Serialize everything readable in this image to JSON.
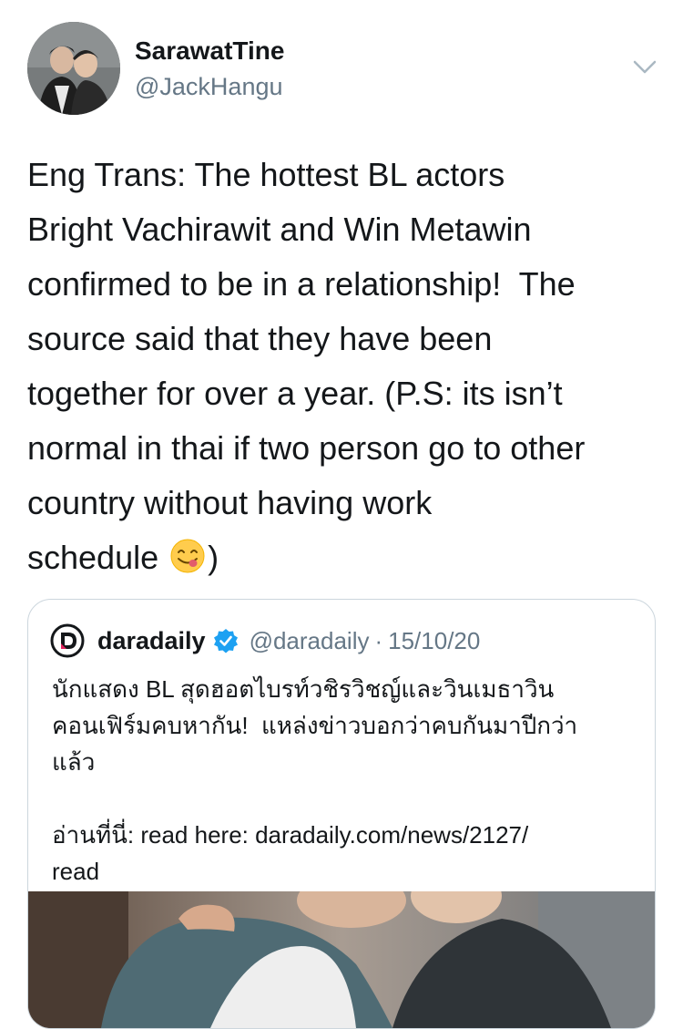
{
  "author": {
    "name": "SarawatTine",
    "handle": "@JackHangu"
  },
  "tweet": {
    "text": "Eng Trans: The hottest BL actors\nBright Vachirawit and Win Metawin\nconfirmed to be in a relationship!  The\nsource said that they have been\ntogether for over a year. (P.S: its isn’t\nnormal in thai if two person go to other\ncountry without having work\nschedule",
    "text_end": ")",
    "emoji": "face-savoring-food-emoji"
  },
  "quoted": {
    "name": "daradaily",
    "handle": "@daradaily",
    "separator": "·",
    "date": "15/10/20",
    "body": "นักแสดง BL สุดฮอตไบรท์วชิรวิชญ์และวินเมธาวิน\nคอนเฟิร์มคบหากัน!  แหล่งข่าวบอกว่าคบกันมาปีกว่า\nแล้ว\n\nอ่านที่นี่: read here: daradaily.com/news/2127/\nread"
  },
  "colors": {
    "text": "#14171a",
    "secondary": "#657786",
    "border": "#ccd6dd",
    "verified": "#1da1f2"
  },
  "icons": {
    "menu": "chevron-down-icon",
    "verified": "verified-badge-icon",
    "logo": "daradaily-logo"
  }
}
